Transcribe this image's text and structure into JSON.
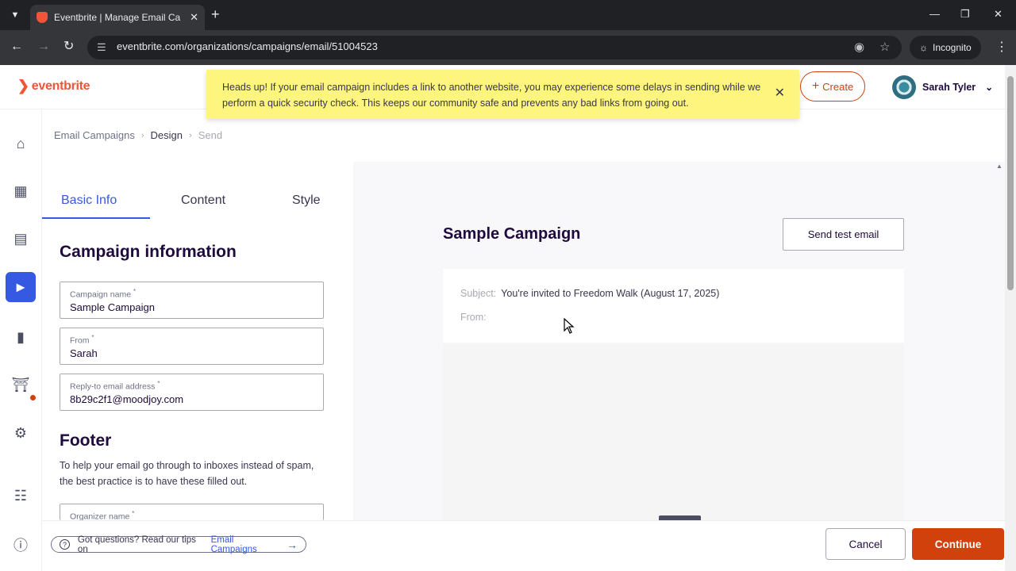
{
  "browser": {
    "tab_title": "Eventbrite | Manage Email Cam",
    "url": "eventbrite.com/organizations/campaigns/email/51004523",
    "incognito_label": "Incognito"
  },
  "header": {
    "logo_text": "eventbrite",
    "banner_text": "Heads up! If your email campaign includes a link to another website, you may experience some delays in sending while we perform a quick security check. This keeps our community safe and prevents any bad links from going out.",
    "create_label": "Create",
    "user_name": "Sarah Tyler"
  },
  "breadcrumb": {
    "items": [
      "Email Campaigns",
      "Design",
      "Send"
    ]
  },
  "tabs": [
    "Basic Info",
    "Content",
    "Style"
  ],
  "form": {
    "section_title": "Campaign information",
    "campaign_name_label": "Campaign name",
    "campaign_name_value": "Sample Campaign",
    "from_label": "From",
    "from_value": "Sarah",
    "reply_label": "Reply-to email address",
    "reply_value": "8b29c2f1@moodjoy.com",
    "footer_title": "Footer",
    "footer_desc": "To help your email go through to inboxes instead of spam, the best practice is to have these filled out.",
    "organizer_label": "Organizer name",
    "required_mark": "*"
  },
  "preview": {
    "title": "Sample Campaign",
    "send_test_label": "Send test email",
    "subject_label": "Subject:",
    "subject_value": "You're invited to Freedom Walk (August 17, 2025)",
    "from_label": "From:"
  },
  "footer_bar": {
    "help_text": "Got questions? Read our tips on",
    "help_link": "Email Campaigns",
    "cancel_label": "Cancel",
    "continue_label": "Continue"
  },
  "colors": {
    "brand": "#f05537",
    "accent": "#3659e3",
    "primary_button": "#d1410c",
    "banner": "#fdf57e"
  }
}
